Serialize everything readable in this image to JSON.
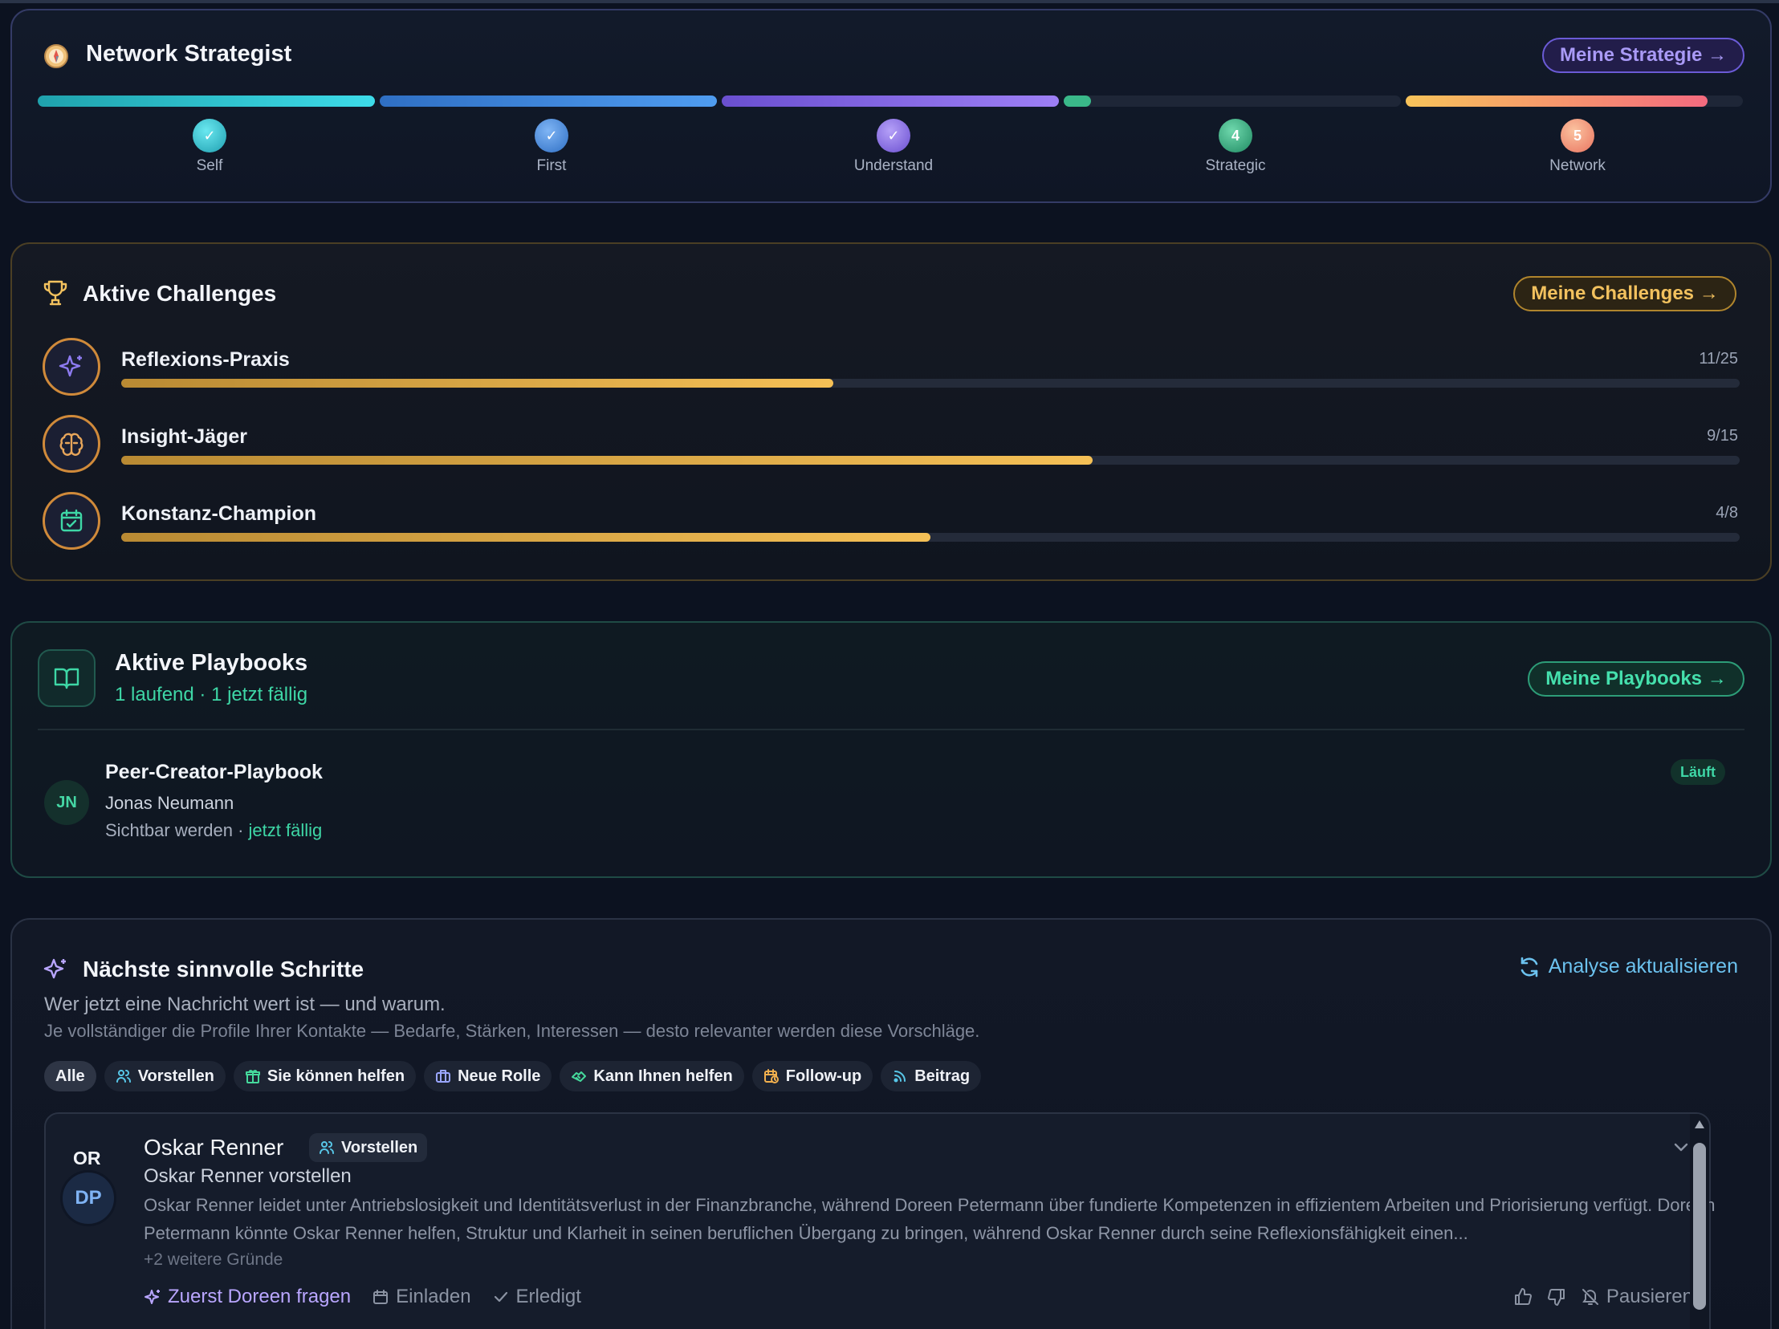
{
  "strategy": {
    "title": "Network Strategist",
    "button": "Meine Strategie →",
    "steps": [
      {
        "label": "Self",
        "marker": "✓",
        "color": "#2fc4d3"
      },
      {
        "label": "First",
        "marker": "✓",
        "color": "#3f8be8"
      },
      {
        "label": "Understand",
        "marker": "✓",
        "color": "#8a6ff0"
      },
      {
        "label": "Strategic",
        "marker": "4",
        "color": "#34b486"
      },
      {
        "label": "Network",
        "marker": "5",
        "color": "#f28a6a"
      }
    ]
  },
  "challenges": {
    "title": "Aktive Challenges",
    "button": "Meine Challenges →",
    "items": [
      {
        "name": "Reflexions-Praxis",
        "count": "11/25",
        "progress": 0.44,
        "icon": "sparkle-icon"
      },
      {
        "name": "Insight-Jäger",
        "count": "9/15",
        "progress": 0.6,
        "icon": "brain-icon"
      },
      {
        "name": "Konstanz-Champion",
        "count": "4/8",
        "progress": 0.5,
        "icon": "calendar-check-icon"
      }
    ]
  },
  "playbooks": {
    "title": "Aktive Playbooks",
    "subtitle": "1 laufend · 1 jetzt fällig",
    "button": "Meine Playbooks →",
    "item": {
      "initials": "JN",
      "name": "Peer-Creator-Playbook",
      "person": "Jonas Neumann",
      "phase": "Sichtbar werden",
      "separator": " · ",
      "due": "jetzt fällig",
      "status": "Läuft"
    }
  },
  "steps": {
    "title": "Nächste sinnvolle Schritte",
    "refresh": "Analyse aktualisieren",
    "subtitle": "Wer jetzt eine Nachricht wert ist — und warum.",
    "hint": "Je vollständiger die Profile Ihrer Kontakte — Bedarfe, Stärken, Interessen — desto relevanter werden diese Vorschläge.",
    "filters": [
      {
        "label": "Alle",
        "icon": ""
      },
      {
        "label": "Vorstellen",
        "icon": "users-icon"
      },
      {
        "label": "Sie können helfen",
        "icon": "gift-icon"
      },
      {
        "label": "Neue Rolle",
        "icon": "briefcase-icon"
      },
      {
        "label": "Kann Ihnen helfen",
        "icon": "handshake-icon"
      },
      {
        "label": "Follow-up",
        "icon": "calendar-clock-icon"
      },
      {
        "label": "Beitrag",
        "icon": "rss-icon"
      }
    ],
    "suggestion": {
      "initials_top": "OR",
      "initials_bottom": "DP",
      "name": "Oskar Renner",
      "badge": "Vorstellen",
      "action_title": "Oskar Renner vorstellen",
      "text": "Oskar Renner leidet unter Antriebslosigkeit und Identitätsverlust in der Finanzbranche, während Doreen Petermann über fundierte Kompetenzen in effizientem Arbeiten und Priorisierung verfügt. Doreen Petermann könnte Oskar Renner helfen, Struktur und Klarheit in seinen beruflichen Übergang zu bringen, während Oskar Renner durch seine Reflexionsfähigkeit einen...",
      "more": "+2 weitere Gründe",
      "actions": {
        "ask_first": "Zuerst Doreen fragen",
        "invite": "Einladen",
        "done": "Erledigt",
        "pause": "Pausieren"
      }
    }
  }
}
